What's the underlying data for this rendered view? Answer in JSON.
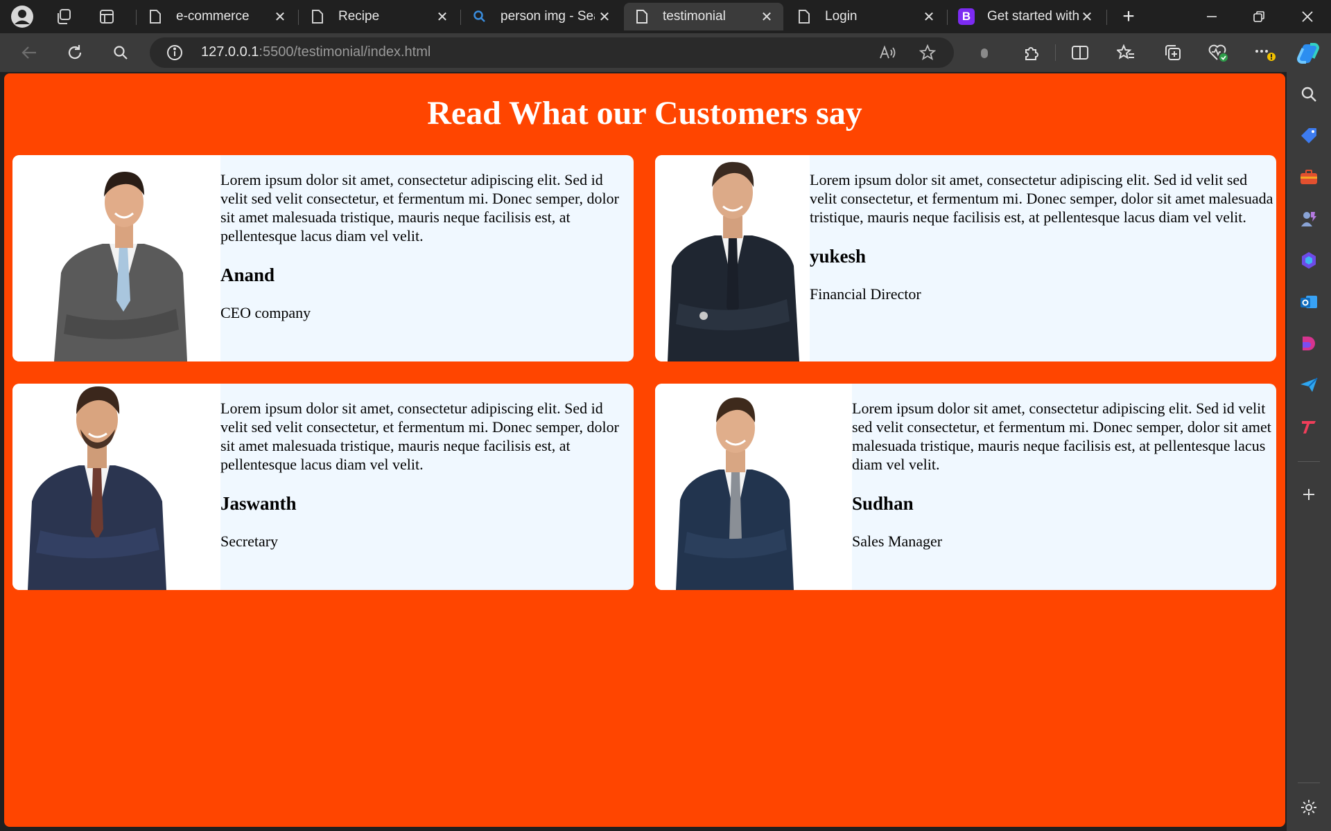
{
  "browser": {
    "tabs": [
      {
        "title": "e-commerce",
        "icon": "page-icon"
      },
      {
        "title": "Recipe",
        "icon": "page-icon"
      },
      {
        "title": "person img - Sea",
        "icon": "search-icon"
      },
      {
        "title": "testimonial",
        "icon": "page-icon",
        "active": true
      },
      {
        "title": "Login",
        "icon": "page-icon"
      },
      {
        "title": "Get started with",
        "icon": "bootstrap-icon"
      }
    ],
    "url_host": "127.0.0.1",
    "url_rest": ":5500/testimonial/index.html",
    "new_tab_label": "+",
    "close_label": "✕",
    "bootstrap_letter": "B"
  },
  "page": {
    "title": "Read What our Customers say",
    "colors": {
      "background": "#ff4500",
      "card": "#f0f8ff",
      "photo_bg": "#ffffff"
    },
    "testimonials": [
      {
        "quote": "Lorem ipsum dolor sit amet, consectetur adipiscing elit. Sed id velit sed velit consectetur, et fermentum mi. Donec semper, dolor sit amet malesuada tristique, mauris neque facilisis est, at pellentesque lacus diam vel velit.",
        "name": "Anand",
        "role": "CEO company",
        "suit_color": "#5a5a5a",
        "tie_color": "#a9c6de"
      },
      {
        "quote": "Lorem ipsum dolor sit amet, consectetur adipiscing elit. Sed id velit sed velit consectetur, et fermentum mi. Donec semper, dolor sit amet malesuada tristique, mauris neque facilisis est, at pellentesque lacus diam vel velit.",
        "name": "yukesh",
        "role": "Financial Director",
        "suit_color": "#1f2631",
        "tie_color": "#1a1f29"
      },
      {
        "quote": "Lorem ipsum dolor sit amet, consectetur adipiscing elit. Sed id velit sed velit consectetur, et fermentum mi. Donec semper, dolor sit amet malesuada tristique, mauris neque facilisis est, at pellentesque lacus diam vel velit.",
        "name": "Jaswanth",
        "role": "Secretary",
        "suit_color": "#2b3550",
        "tie_color": "#6e3b30"
      },
      {
        "quote": "Lorem ipsum dolor sit amet, consectetur adipiscing elit. Sed id velit sed velit consectetur, et fermentum mi. Donec semper, dolor sit amet malesuada tristique, mauris neque facilisis est, at pellentesque lacus diam vel velit.",
        "name": "Sudhan",
        "role": "Sales Manager",
        "suit_color": "#22344e",
        "tie_color": "#8a8f96"
      }
    ]
  }
}
